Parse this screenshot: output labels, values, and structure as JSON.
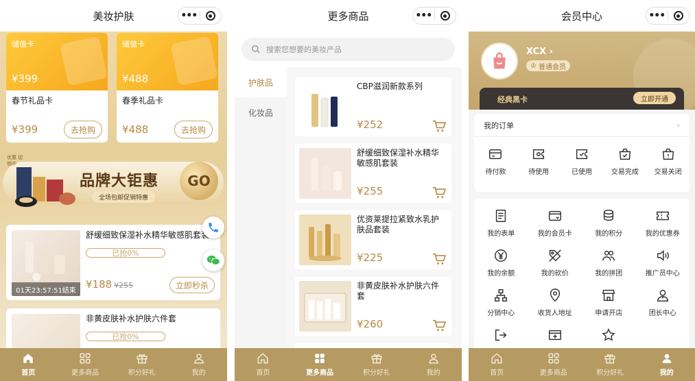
{
  "colors": {
    "accent": "#b58a45",
    "tabbar": "#b59a62",
    "gold_card": "#f5a81d"
  },
  "tabbar": [
    {
      "label": "首页",
      "icon": "home-icon"
    },
    {
      "label": "更多商品",
      "icon": "grid-icon"
    },
    {
      "label": "积分好礼",
      "icon": "gift-icon"
    },
    {
      "label": "我的",
      "icon": "user-icon"
    }
  ],
  "home": {
    "title": "美妆护肤",
    "gift_cards": [
      {
        "tag": "储值卡",
        "amount": "¥399",
        "name": "春节礼品卡",
        "price": "¥399",
        "button": "去抢购"
      },
      {
        "tag": "储值卡",
        "amount": "¥488",
        "name": "春季礼品卡",
        "price": "¥488",
        "button": "去抢购"
      }
    ],
    "banner": {
      "badge": "优惠 促销中",
      "headline": "品牌大钜惠",
      "sub": "全场包邮促销特惠",
      "go": "GO"
    },
    "flash_items": [
      {
        "name": "舒缓细致保湿补水精华敏感肌套装",
        "progress": "已抢0%",
        "progress_value": 0,
        "timer": "01天23:57:51结束",
        "price": "¥188",
        "old_price": "¥255",
        "button": "立即秒杀"
      },
      {
        "name": "非黄皮肤补水护肤六件套",
        "progress": "已抢0%",
        "progress_value": 0
      }
    ]
  },
  "more": {
    "title": "更多商品",
    "search_placeholder": "搜索您想要的美妆产品",
    "categories": [
      "护肤品",
      "化妆品"
    ],
    "products": [
      {
        "name": "CBP滋润新款系列",
        "price": "¥252"
      },
      {
        "name": "舒缓细致保湿补水精华敏感肌套装",
        "price": "¥255"
      },
      {
        "name": "优资莱提拉紧致水乳护肤品套装",
        "price": "¥225"
      },
      {
        "name": "非黄皮肤补水护肤六件套",
        "price": "¥260"
      }
    ]
  },
  "member": {
    "title": "会员中心",
    "username": "XCX",
    "level": "普通会员",
    "black_card": "经典黑卡",
    "open_button": "立即开通",
    "orders_title": "我的订单",
    "orders": [
      {
        "label": "待付款",
        "icon": "wallet-icon"
      },
      {
        "label": "待使用",
        "icon": "ticket-icon"
      },
      {
        "label": "已使用",
        "icon": "ticket-used-icon"
      },
      {
        "label": "交易完成",
        "icon": "bag-check-icon"
      },
      {
        "label": "交易关闭",
        "icon": "bag-close-icon"
      }
    ],
    "services": [
      {
        "label": "我的表单",
        "icon": "form-icon"
      },
      {
        "label": "我的会员卡",
        "icon": "card-icon"
      },
      {
        "label": "我的积分",
        "icon": "coins-icon"
      },
      {
        "label": "我的优惠券",
        "icon": "coupon-icon"
      },
      {
        "label": "我的余额",
        "icon": "yen-icon"
      },
      {
        "label": "我的砍价",
        "icon": "tag-icon"
      },
      {
        "label": "我的拼团",
        "icon": "group-icon"
      },
      {
        "label": "推广员中心",
        "icon": "speaker-icon"
      },
      {
        "label": "分销中心",
        "icon": "network-icon"
      },
      {
        "label": "收货人地址",
        "icon": "location-icon"
      },
      {
        "label": "申请开店",
        "icon": "store-icon"
      },
      {
        "label": "团长中心",
        "icon": "leader-icon"
      },
      {
        "label": "",
        "icon": "exit-icon"
      },
      {
        "label": "",
        "icon": "card-add-icon"
      },
      {
        "label": "",
        "icon": "star-icon"
      }
    ]
  }
}
